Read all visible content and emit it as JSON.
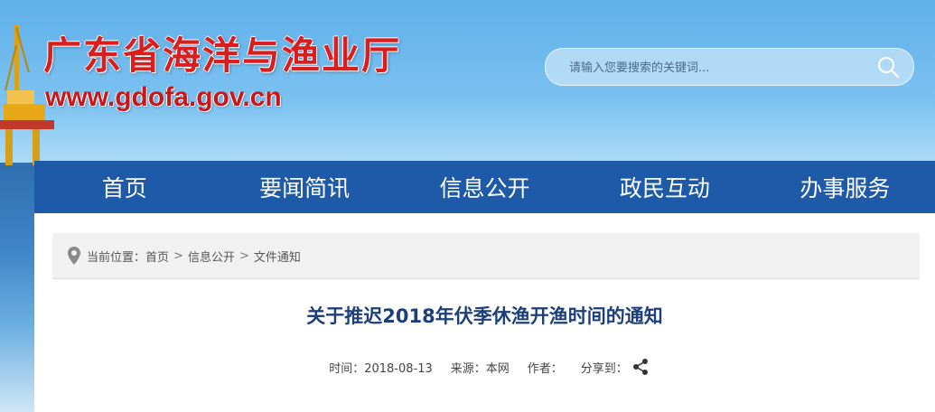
{
  "header": {
    "site_title": "广东省海洋与渔业厅",
    "site_url": "www.gdofa.gov.cn",
    "search": {
      "placeholder": "请输入您要搜索的关键词..."
    }
  },
  "nav": {
    "items": [
      {
        "label": "首页"
      },
      {
        "label": "要闻简讯"
      },
      {
        "label": "信息公开"
      },
      {
        "label": "政民互动"
      },
      {
        "label": "办事服务"
      }
    ]
  },
  "breadcrumb": {
    "prefix": "当前位置：",
    "items": [
      "首页",
      "信息公开",
      "文件通知"
    ],
    "separator": ">"
  },
  "article": {
    "title": "关于推迟2018年伏季休渔开渔时间的通知",
    "time": "时间：2018-08-13",
    "source": "来源：本网",
    "author": "作者：",
    "share": "分享到："
  },
  "colors": {
    "nav_bg": "#1e5aa8",
    "title_red": "#d81e1e",
    "article_title": "#1c3f7a"
  },
  "icons": [
    "location-pin-icon",
    "search-icon",
    "share-icon"
  ]
}
